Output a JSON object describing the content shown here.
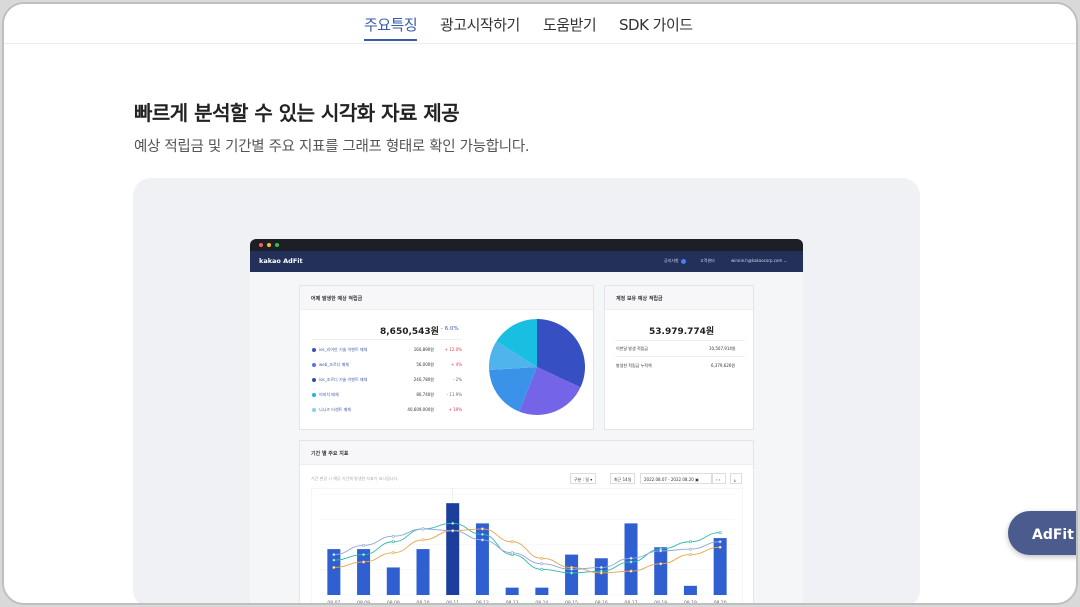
{
  "nav": {
    "items": [
      "주요특징",
      "광고시작하기",
      "도움받기",
      "SDK 가이드"
    ],
    "active": 0
  },
  "hero": {
    "title": "빠르게 분석할 수 있는 시각화 자료 제공",
    "subtitle": "예상 적립금 및 기간별 주요 지표를 그래프 형태로 확인 가능합니다."
  },
  "fab": {
    "label": "AdFit 시"
  },
  "mockup": {
    "logo": "kakao AdFit",
    "menu": {
      "notice": "공지사항",
      "support": "고객센터",
      "account": "winnie.h@kakaocorp.com ⌄"
    },
    "earnings_card": {
      "title": "어제 발생한 예상 적립금",
      "total": "8,650,543원",
      "delta": "- 6.0%",
      "rows": [
        {
          "label": "ios_리어안 기술 이벤트 매체",
          "value": "160,890원",
          "change": "+ 12.0%",
          "dir": "up",
          "color": "#3a4fbf"
        },
        {
          "label": "web_조르디 매체",
          "value": "56,000원",
          "change": "+ 4%",
          "dir": "up",
          "color": "#5a6fe8"
        },
        {
          "label": "ios_조르디 기술 이벤트 매체",
          "value": "240,780원",
          "change": "- 2%",
          "dir": "down",
          "color": "#2d4fa8"
        },
        {
          "label": "어피치 매체",
          "value": "80,740원",
          "change": "- 11.9%",
          "dir": "down",
          "color": "#1bb8d6"
        },
        {
          "label": "니니즈 티센트 매체",
          "value": "40,609,000원",
          "change": "+ 19%",
          "dir": "up",
          "color": "#7fd3f0"
        }
      ]
    },
    "pie": [
      {
        "value": 32,
        "color": "#3650c4"
      },
      {
        "value": 24,
        "color": "#7464e8"
      },
      {
        "value": 18,
        "color": "#3a93e8"
      },
      {
        "value": 10,
        "color": "#4fb4ec"
      },
      {
        "value": 16,
        "color": "#19bfe0"
      }
    ],
    "balance_card": {
      "title": "계정 보유 예상 적립금",
      "total": "53.979.774원",
      "rows": [
        {
          "label": "이번달 발생 적립금",
          "value": "10,507,914원"
        },
        {
          "label": "발생한 적립금 누적액",
          "value": "6,379,626원"
        }
      ]
    },
    "period_card": {
      "title": "기간 별 주요 지표",
      "hint": "기간 변경 시 해당 기간에 발생한 지표가 표시됩니다.",
      "controls": {
        "unit": "구분 : 일 ▾",
        "recent": "최근 14일",
        "range": "2022.08.07 - 2022.08.20",
        "calendar_icon": "▣",
        "nav": "‹ ›",
        "download_icon": "⤓"
      }
    }
  },
  "chart_data": {
    "type": "bar",
    "categories": [
      "08.07",
      "08.08",
      "08.09",
      "08.10",
      "08.11",
      "08.12",
      "08.13",
      "08.14",
      "08.15",
      "08.16",
      "08.17",
      "08.18",
      "08.19",
      "08.20"
    ],
    "series": [
      {
        "values": [
          50,
          50,
          30,
          50,
          100,
          78,
          8,
          8,
          44,
          40,
          78,
          52,
          10,
          62
        ]
      }
    ],
    "lines": [
      {
        "values": [
          38,
          44,
          58,
          72,
          78,
          66,
          44,
          28,
          24,
          26,
          36,
          50,
          58,
          68
        ],
        "color": "#2fb7a8"
      },
      {
        "values": [
          30,
          36,
          46,
          60,
          70,
          72,
          58,
          40,
          30,
          24,
          26,
          34,
          44,
          52
        ],
        "color": "#e6a64c"
      },
      {
        "values": [
          44,
          54,
          64,
          72,
          70,
          60,
          46,
          34,
          28,
          30,
          40,
          48,
          50,
          58
        ],
        "color": "#8ea8d8"
      }
    ],
    "highlight_index": 4,
    "ylim": [
      0,
      110
    ],
    "colors": {
      "bar": "#2f5fd0",
      "bar_highlight": "#1c3e9c"
    }
  }
}
